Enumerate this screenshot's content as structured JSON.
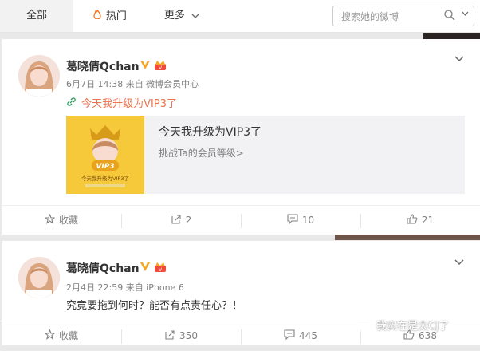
{
  "nav": {
    "tabs": [
      {
        "label": "全部",
        "active": true
      },
      {
        "label": "热门",
        "icon": "flame-icon"
      },
      {
        "label": "更多",
        "icon": "chevron-down-icon"
      }
    ],
    "search_placeholder": "搜索她的微博"
  },
  "posts": [
    {
      "author": "葛晓倩Qchan",
      "meta": "6月7日 14:38 来自 微博会员中心",
      "text": "今天我升级为VIP3了",
      "share": {
        "title": "今天我升级为VIP3了",
        "subtitle": "挑战Ta的会员等级>",
        "thumb_badge": "VIP3",
        "thumb_caption": "今天我升级为VIP3了"
      },
      "actions": {
        "favorite": "收藏",
        "repost": "2",
        "comment": "10",
        "like": "21"
      }
    },
    {
      "author": "葛晓倩Qchan",
      "meta": "2月4日 22:59 来自 iPhone 6",
      "text": "究竟要拖到何时？能否有点责任心？！",
      "actions": {
        "favorite": "收藏",
        "repost": "350",
        "comment": "445",
        "like": "638"
      }
    }
  ],
  "watermark": "我实在是太CJ了",
  "colors": {
    "accent": "#eb7350",
    "vip": "#f5a623",
    "muted": "#808080"
  }
}
